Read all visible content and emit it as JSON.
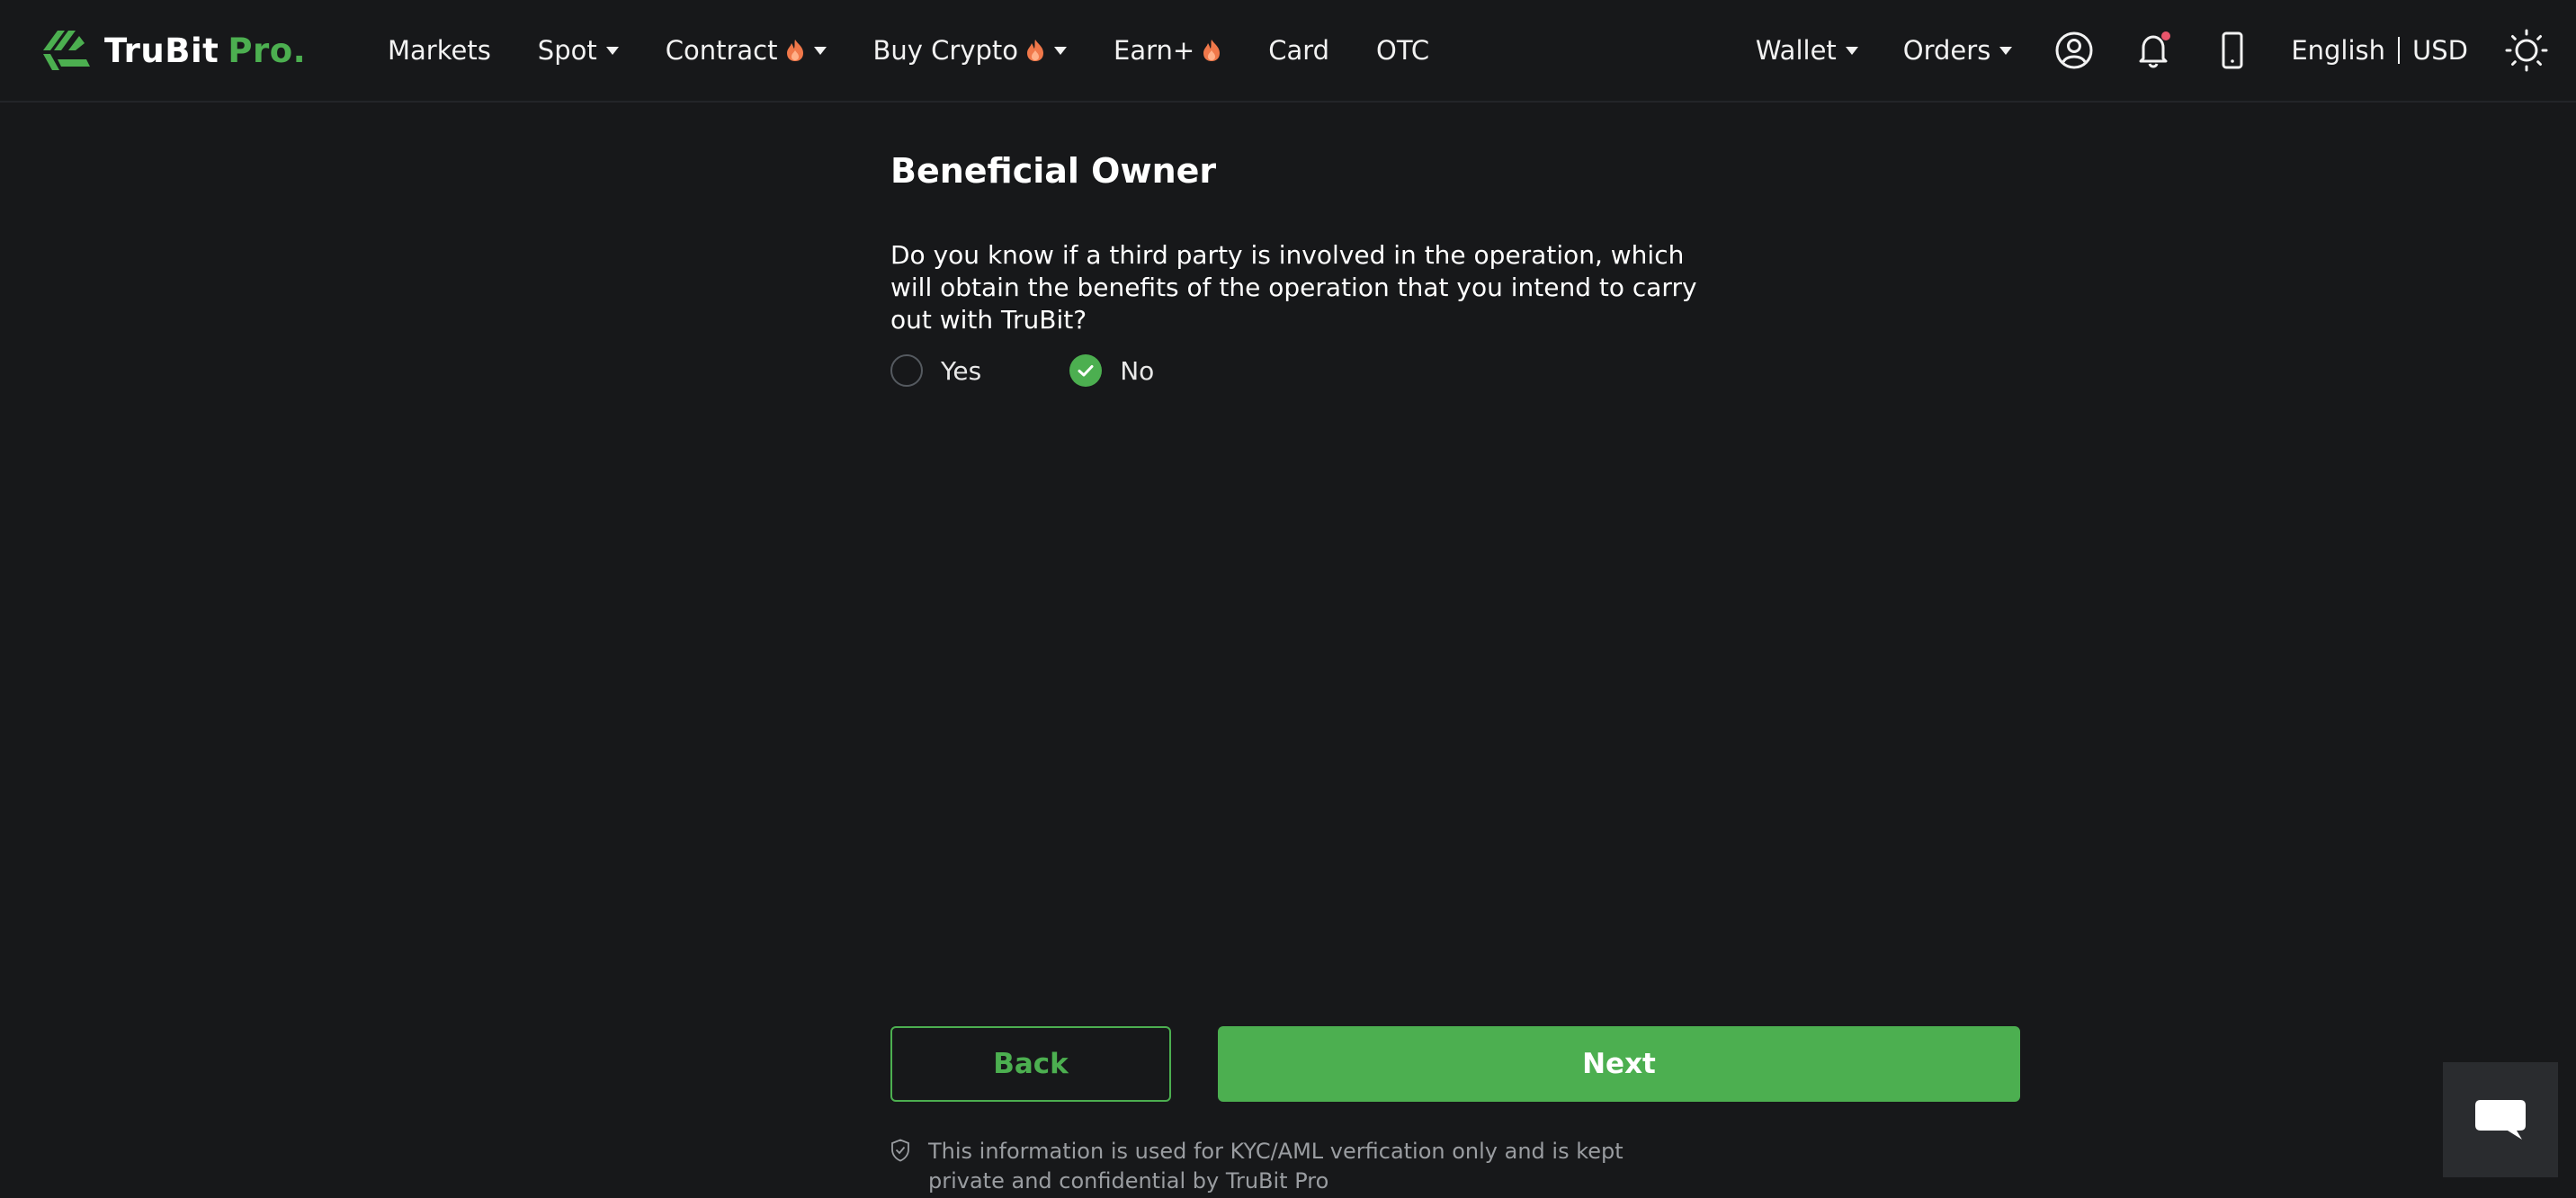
{
  "header": {
    "logo": {
      "brand": "TruBit",
      "suffix": "Pro."
    },
    "nav": [
      {
        "label": "Markets",
        "caret": false,
        "fire": false
      },
      {
        "label": "Spot",
        "caret": true,
        "fire": false
      },
      {
        "label": "Contract",
        "caret": true,
        "fire": true
      },
      {
        "label": "Buy Crypto",
        "caret": true,
        "fire": true
      },
      {
        "label": "Earn+",
        "caret": false,
        "fire": true
      },
      {
        "label": "Card",
        "caret": false,
        "fire": false
      },
      {
        "label": "OTC",
        "caret": false,
        "fire": false
      }
    ],
    "right": {
      "wallet": "Wallet",
      "orders": "Orders",
      "language": "English",
      "currency": "USD"
    }
  },
  "form": {
    "title": "Beneficial Owner",
    "question": "Do you know if a third party is involved in the operation, which will obtain the benefits of the operation that you intend to carry out with TruBit?",
    "options": [
      {
        "label": "Yes",
        "selected": false
      },
      {
        "label": "No",
        "selected": true
      }
    ],
    "back_label": "Back",
    "next_label": "Next",
    "notice": "This information is used for KYC/AML verfication only and is kept private and confidential by TruBit Pro"
  },
  "colors": {
    "background": "#17181a",
    "accent": "#4caf50",
    "notification_dot": "#e8556b",
    "fire": "#f0784a"
  },
  "icons": {
    "profile": "user-circle-icon",
    "notifications": "bell-icon",
    "app": "mobile-phone-icon",
    "theme": "sun-icon",
    "chat": "chat-bubble-icon",
    "notice": "shield-check-icon"
  }
}
